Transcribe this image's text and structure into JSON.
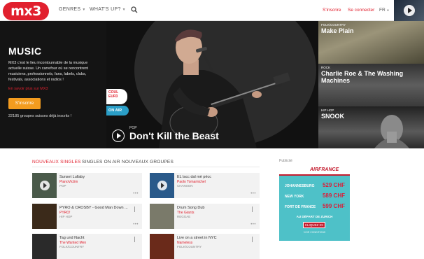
{
  "nav": {
    "logo": "mx3",
    "genres": "GENRES",
    "whats_up": "WHAT'S UP?",
    "signup": "S'inscrire",
    "login": "Se connecter",
    "lang": "FR"
  },
  "hero": {
    "title": "MUSIC",
    "description": "MX3 c'est le lieu incontournable de la musique actuelle suisse. Un carrefour où se rencontrent musiciens, professionnels, fans, labels, clubs, festivals, associations et radios !",
    "more_link": "En savoir plus sur MX3",
    "signup_button": "S'inscrire",
    "count": "22185 groupes suisses déjà inscrits !",
    "badge_couleur": "COUL EUR3",
    "badge_onair": "ON AIR",
    "main_genre": "POP",
    "main_title": "Don't Kill the Beast",
    "side": [
      {
        "genre": "FOLK/COUNTRY",
        "name": "Make Plain"
      },
      {
        "genre": "ROCK",
        "name": "Charlie Roe & The Washing Machines"
      },
      {
        "genre": "HIP HOP",
        "name": "SNOOK"
      }
    ]
  },
  "tabs": [
    "NOUVEAUX SINGLES",
    "SINGLES ON AIR",
    "NOUVEAUX GROUPES"
  ],
  "singles": [
    {
      "title": "Sunset Lullaby",
      "artist": "PianoVictim",
      "genre": "POP",
      "color": "#4a5a4a"
    },
    {
      "title": "EL lacc dal mè pécc",
      "artist": "Paolo Tomamichel",
      "genre": "CHANSON",
      "color": "#2a5a8a"
    },
    {
      "title": "PYRO & CROSBY - Good Man Down ...",
      "artist": "PYRO!",
      "genre": "HIP HOP",
      "color": "#3b2a1a"
    },
    {
      "title": "Drum Song Dub",
      "artist": "The Giants",
      "genre": "REGGAE",
      "color": "#7a7a6a"
    },
    {
      "title": "Tag und Nacht",
      "artist": "The Wanted Men",
      "genre": "FOLK/COUNTRY",
      "color": "#2a2a2a"
    },
    {
      "title": "Live on a street in NYC",
      "artist": "Nameless",
      "genre": "FOLK/COUNTRY",
      "color": "#6a2a1a"
    }
  ],
  "ad": {
    "label": "Publicité",
    "brand": "AIRFRANCE",
    "routes": [
      {
        "city": "JOHANNESBURG",
        "price": "529 CHF"
      },
      {
        "city": "NEW YORK",
        "price": "589 CHF"
      },
      {
        "city": "FORT DE FRANCE",
        "price": "599 CHF"
      }
    ],
    "departure": "AU DÉPART DE ZURICH",
    "button": "CLIQUEZ ICI",
    "conditions": "VOIR CONDITIONS",
    "accent": "#c41c2e",
    "background": "#4ec1c8"
  },
  "colors": {
    "brand": "#e1202e",
    "signup_button": "#f39c1f",
    "onair": "#2a9ec7"
  }
}
